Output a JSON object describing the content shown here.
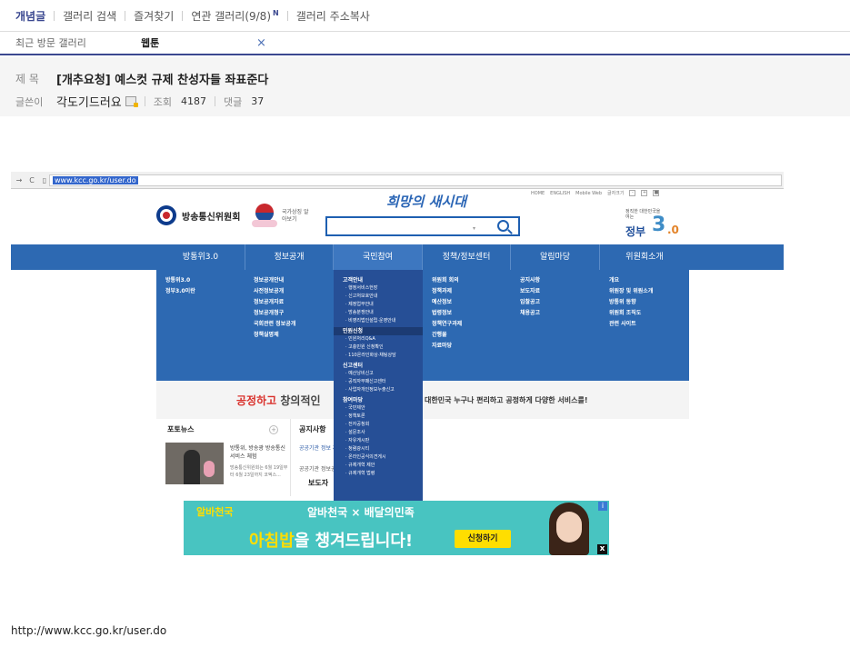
{
  "topnav": {
    "items": [
      "개념글",
      "갤러리 검색",
      "즐겨찾기",
      "연관 갤러리(9/8)",
      "갤러리 주소복사"
    ],
    "new_badge": "N"
  },
  "recent": {
    "label": "최근 방문 갤러리",
    "gallery": "웹툰",
    "close": "×"
  },
  "post": {
    "title_label": "제 목",
    "title": "[개추요청] 예스컷 규제 찬성자들 좌표준다",
    "writer_label": "글쓴이",
    "writer": "각도기드러요",
    "views_label": "조회",
    "views": "4187",
    "comments_label": "댓글",
    "comments": "37"
  },
  "screenshot": {
    "address": "www.kcc.go.kr/user.do",
    "site_name": "방송통신위원회",
    "flag_caption": "국가상징 알아보기",
    "slogan": "희망의 새시대",
    "search_hint": "▾",
    "util_links": [
      "HOME",
      "ENGLISH",
      "Mobile Web",
      "글자크기",
      "-",
      "+",
      "■"
    ],
    "gov_tagline": "정직한 대한민국을 여는",
    "gov_label": "정부",
    "gov_three": "3",
    "gov_zero": ".0",
    "menu": [
      "방통위3.0",
      "정보공개",
      "국민참여",
      "정책/정보센터",
      "알림마당",
      "위원회소개"
    ],
    "dropdown": {
      "col1": [
        "방통위3.0",
        "정부3.0이란"
      ],
      "col2": [
        "정보공개안내",
        "사전정보공개",
        "정보공개자료",
        "정보공개청구",
        "국회관련 정보공개",
        "정책실명제"
      ],
      "col4": [
        "위원회 회의",
        "정책과제",
        "예산정보",
        "법령정보",
        "정책연구과제",
        "간행물",
        "자료마당"
      ],
      "col5": [
        "공지사항",
        "보도자료",
        "입찰공고",
        "채용공고"
      ],
      "col6": [
        "개요",
        "위원장 및 위원소개",
        "방통위 동향",
        "위원회 조직도",
        "관련 사이트"
      ]
    },
    "midcol": {
      "h1": "고객안내",
      "s1": [
        "· 행정서비스헌장",
        "· 신고처보호안내",
        "· 제정업무안내",
        "· 방송분쟁안내",
        "· 비영리법인설립·운영안내"
      ],
      "h2": "민원신청",
      "s2": [
        "· 민원처리Q&A",
        "· 고충민원 신청확인",
        "· 110온라인화상·채팅상담"
      ],
      "h3": "신고센터",
      "s3": [
        "· 예산낭비신고",
        "· 공직자부패신고센터",
        "· 사업자개인정보누출신고"
      ],
      "h4": "참여마당",
      "s4": [
        "· 국민제안",
        "· 정책토론",
        "· 전자공청회",
        "· 설문조사",
        "· 자유게시판",
        "· 청렴광시티",
        "· 온라인공식의견게시",
        "· 규제개혁 제안",
        "· 규제개혁 법령"
      ]
    },
    "banner": {
      "t1_red": "공정하고",
      "t1_rest": "창의적인",
      "t2": "대한민국 누구나 편리하고 공정하게 다양한 서비스를!"
    },
    "news": {
      "photo_header": "포토뉴스",
      "plus": "+",
      "caption": "방통위, 방송광 방송통신 서비스 체험",
      "caption2": "방송통신위원회는 6월 19일부터 6월 23일까지 코엑스...",
      "notice_header": "공지사항",
      "notice_line": "공공기관 정보 제공 사항 알림",
      "notice_line2": "공공기관 정보공",
      "press_header": "보도자"
    },
    "ad": {
      "brand1": "알바천국",
      "brand2": "알바천국 × 배달의민족",
      "main_yellow": "아침밥",
      "main_rest": "을 챙겨드립니다!",
      "cta": "신청하기",
      "info": "i",
      "close": "x"
    }
  },
  "bottom_url": "http://www.kcc.go.kr/user.do"
}
